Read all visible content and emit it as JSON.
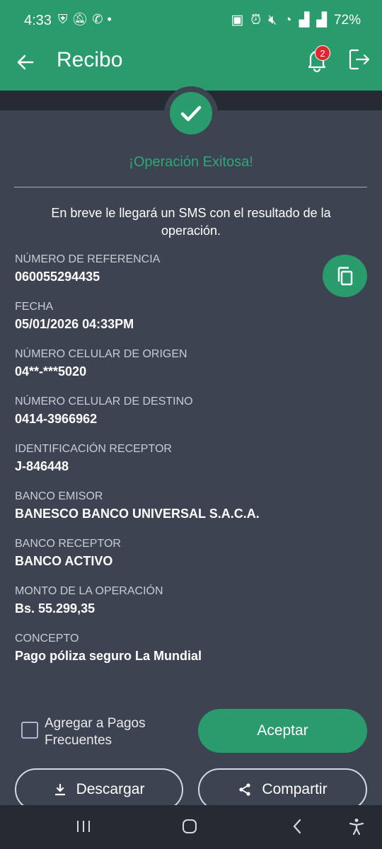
{
  "status_bar": {
    "time": "4:33",
    "left_icons": [
      "shield-check-icon",
      "mute-bell-icon",
      "whatsapp-icon",
      "dot-icon"
    ],
    "right_icons": [
      "battery-saver-icon",
      "alarm-icon",
      "muted-icon",
      "wifi-icon",
      "signal-icon",
      "signal-icon"
    ],
    "battery": "72%"
  },
  "app_bar": {
    "title": "Recibo",
    "notification_count": "2"
  },
  "receipt": {
    "success_message": "¡Operación Exitosa!",
    "sms_notice": "En breve le llegará un SMS con el resultado de la operación.",
    "fields": [
      {
        "label": "NÚMERO DE REFERENCIA",
        "value": "060055294435"
      },
      {
        "label": "FECHA",
        "value": "05/01/2026 04:33PM"
      },
      {
        "label": "NÚMERO CELULAR DE ORIGEN",
        "value": "04**-***5020"
      },
      {
        "label": "NÚMERO CELULAR DE DESTINO",
        "value": "0414-3966962"
      },
      {
        "label": "IDENTIFICACIÓN RECEPTOR",
        "value": "J-846448"
      },
      {
        "label": "BANCO EMISOR",
        "value": "BANESCO BANCO UNIVERSAL S.A.C.A."
      },
      {
        "label": "BANCO RECEPTOR",
        "value": "BANCO ACTIVO"
      },
      {
        "label": "MONTO DE LA OPERACIÓN",
        "value": "Bs. 55.299,35"
      },
      {
        "label": "CONCEPTO",
        "value": "Pago póliza seguro La Mundial"
      }
    ]
  },
  "actions": {
    "frequent_checkbox_label": "Agregar a Pagos Frecuentes",
    "frequent_checked": false,
    "accept_label": "Aceptar",
    "download_label": "Descargar",
    "share_label": "Compartir"
  },
  "colors": {
    "primary": "#2a9b6d",
    "background": "#3d4351",
    "dark": "#262a33",
    "badge": "#e0262c"
  }
}
